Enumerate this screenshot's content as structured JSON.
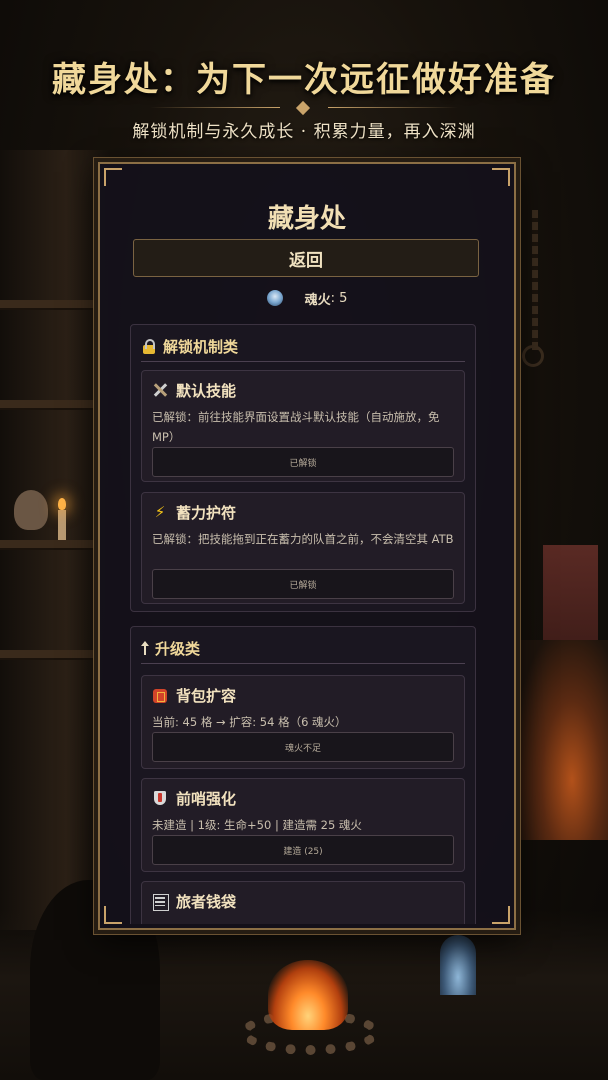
{
  "header": {
    "title": "藏身处：为下一次远征做好准备",
    "subtitle": "解锁机制与永久成长 · 积累力量，再入深渊"
  },
  "panel": {
    "title": "藏身处",
    "back_label": "返回",
    "soulfire": {
      "icon": "blue-skull-icon",
      "label": "魂火",
      "value": "5",
      "text": ": 5"
    }
  },
  "sections": [
    {
      "icon": "lock-icon",
      "title": "解锁机制类",
      "cards": [
        {
          "icon": "crossed-swords-icon",
          "title": "默认技能",
          "desc": "已解锁：前往技能界面设置战斗默认技能（自动施放，免 MP）",
          "button": "已解锁"
        },
        {
          "icon": "lightning-icon",
          "title": "蓄力护符",
          "desc": "已解锁：把技能拖到正在蓄力的队首之前，不会清空其 ATB",
          "button": "已解锁"
        }
      ]
    },
    {
      "icon": "up-arrow-icon",
      "title": "升级类",
      "cards": [
        {
          "icon": "backpack-icon",
          "title": "背包扩容",
          "desc": "当前: 45 格 → 扩容: 54 格（6 魂火）",
          "button": "魂火不足"
        },
        {
          "icon": "shield-icon",
          "title": "前哨强化",
          "desc": "未建造 | 1级: 生命+50 | 建造需 25 魂火",
          "button": "建造 (25)"
        },
        {
          "icon": "purse-icon",
          "title": "旅者钱袋",
          "desc": "",
          "button": ""
        }
      ]
    }
  ],
  "colors": {
    "gold": "#f0d89a",
    "panel_bg": "#14111a",
    "frame": "#8c6f45"
  }
}
